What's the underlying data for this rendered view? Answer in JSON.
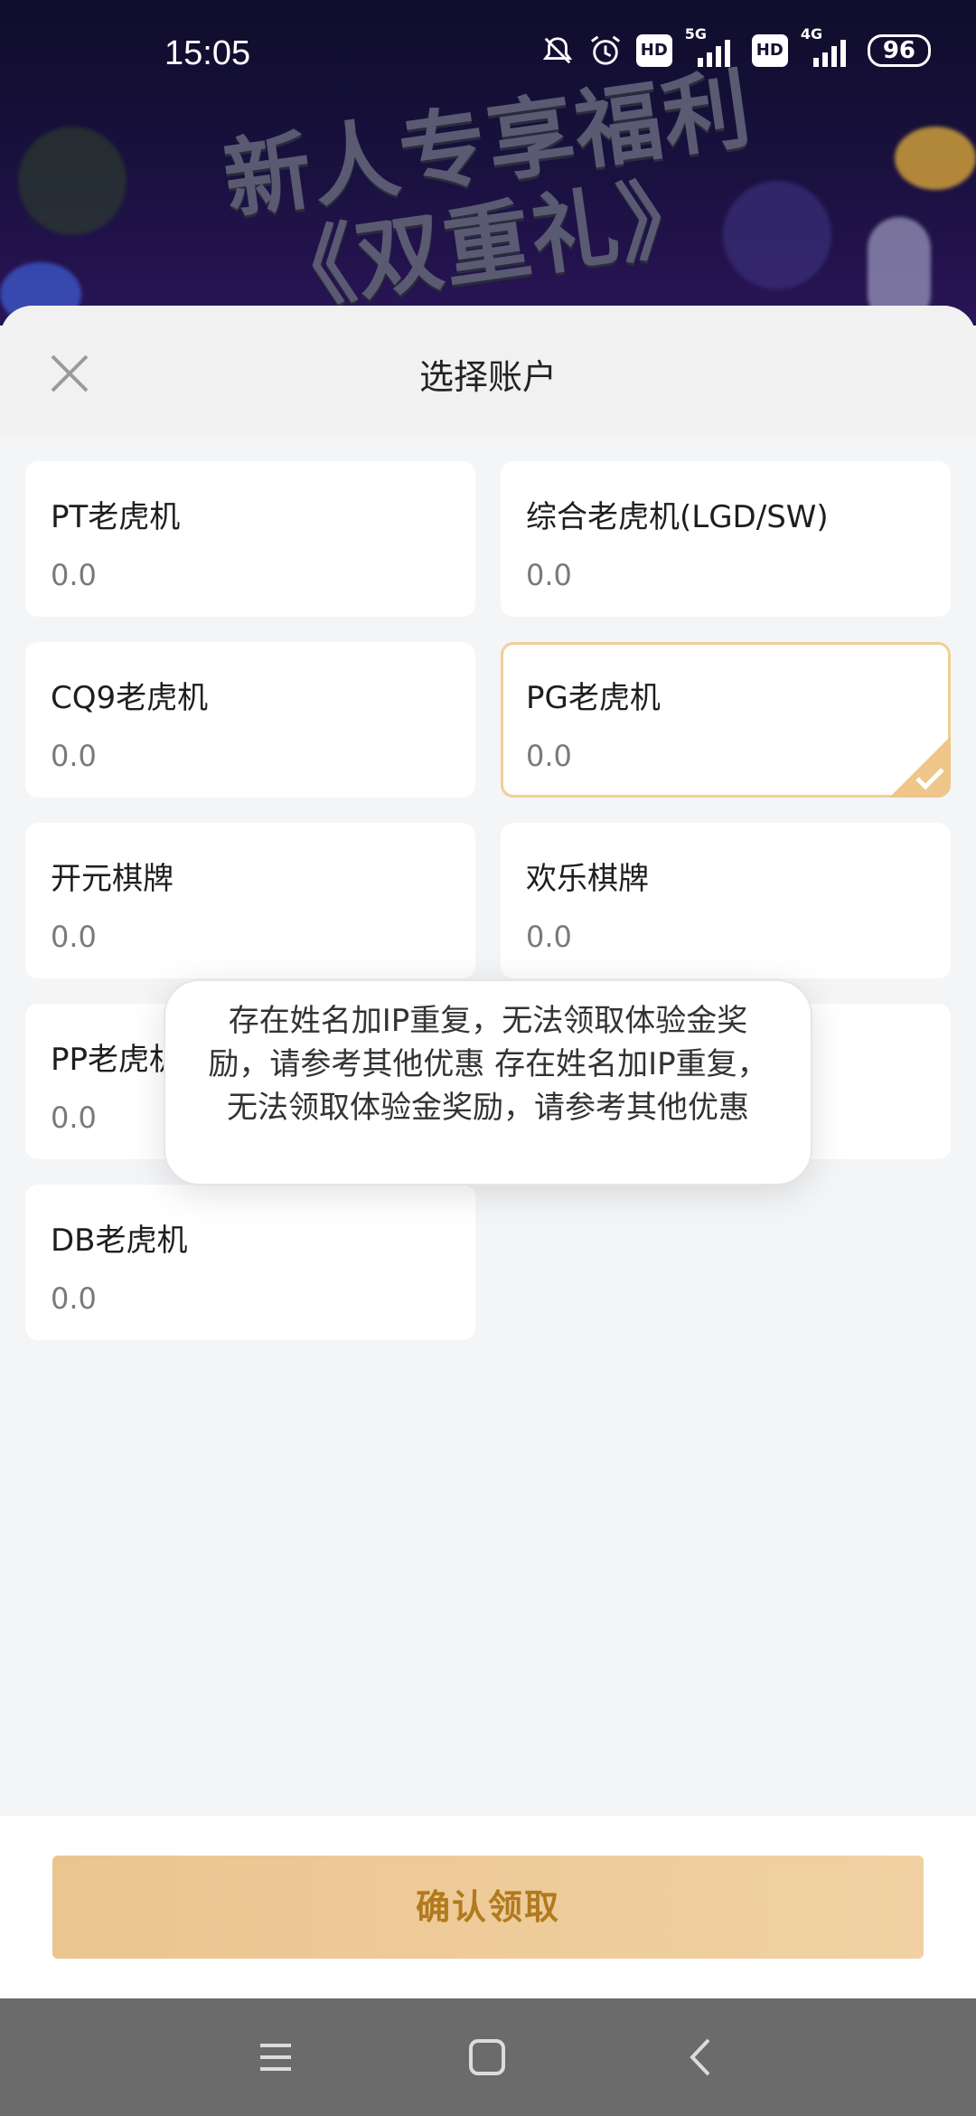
{
  "status_bar": {
    "time": "15:05",
    "icons": [
      "bell-off-icon",
      "alarm-icon",
      "hd-icon",
      "5g-signal-icon",
      "hd-icon",
      "4g-signal-icon"
    ],
    "network_1": "5G",
    "network_2": "4G",
    "hd_label": "HD",
    "battery": "96"
  },
  "banner": {
    "line1": "新人专享福利",
    "line2": "《双重礼》"
  },
  "sheet": {
    "title": "选择账户",
    "accounts": [
      {
        "name": "PT老虎机",
        "value": "0.0",
        "selected": false
      },
      {
        "name": "综合老虎机(LGD/SW)",
        "value": "0.0",
        "selected": false
      },
      {
        "name": "CQ9老虎机",
        "value": "0.0",
        "selected": false
      },
      {
        "name": "PG老虎机",
        "value": "0.0",
        "selected": true
      },
      {
        "name": "开元棋牌",
        "value": "0.0",
        "selected": false
      },
      {
        "name": "欢乐棋牌",
        "value": "0.0",
        "selected": false
      },
      {
        "name": "PP老虎机",
        "value": "0.0",
        "selected": false
      },
      {
        "name": "",
        "value": "",
        "selected": false
      },
      {
        "name": "DB老虎机",
        "value": "0.0",
        "selected": false
      }
    ]
  },
  "toast": {
    "message": "存在姓名加IP重复，无法领取体验金奖励，请参考其他优惠 存在姓名加IP重复，无法领取体验金奖励，请参考其他优惠"
  },
  "footer": {
    "confirm_label": "确认领取"
  },
  "colors": {
    "accent": "#ebc58f",
    "accent_text": "#b07a1d",
    "selected_border": "#efcf96"
  }
}
